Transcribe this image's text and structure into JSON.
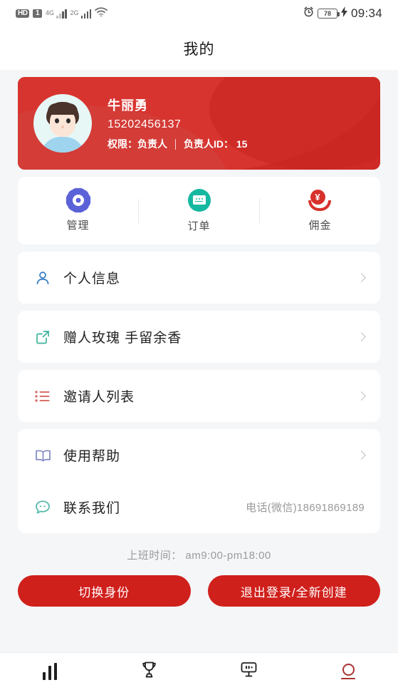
{
  "status_bar": {
    "hd_label": "HD",
    "sim_label": "1",
    "net_primary": "4G",
    "net_secondary": "2G",
    "wifi_icon": "wifi-icon",
    "alarm_icon": "alarm-icon",
    "battery_percent": "78",
    "charging_icon": "charging-bolt-icon",
    "time": "09:34"
  },
  "header": {
    "title": "我的"
  },
  "profile": {
    "avatar_icon": "user-avatar",
    "name": "牛丽勇",
    "phone": "15202456137",
    "role_text": "权限：负责人",
    "id_text": "负责人ID： 15",
    "card_color": "#cf2a26"
  },
  "quick_actions": [
    {
      "label": "管理",
      "icon": "gear-icon",
      "color": "#5b62d8"
    },
    {
      "label": "订单",
      "icon": "order-card-icon",
      "color": "#16b8a0"
    },
    {
      "label": "佣金",
      "icon": "commission-hand-yen-icon",
      "color": "#d8312c"
    }
  ],
  "menu_groups": [
    {
      "rows": [
        {
          "label": "个人信息",
          "icon": "person-icon",
          "icon_color": "#2f78c4",
          "right_text": "",
          "chevron": true
        }
      ]
    },
    {
      "rows": [
        {
          "label": "赠人玫瑰 手留余香",
          "icon": "share-external-icon",
          "icon_color": "#3cb39a",
          "right_text": "",
          "chevron": true
        }
      ]
    },
    {
      "rows": [
        {
          "label": "邀请人列表",
          "icon": "list-icon",
          "icon_color": "#d8706a",
          "right_text": "",
          "chevron": true
        }
      ]
    },
    {
      "rows": [
        {
          "label": "使用帮助",
          "icon": "book-icon",
          "icon_color": "#8289c4",
          "right_text": "",
          "chevron": true
        },
        {
          "label": "联系我们",
          "icon": "chat-bubble-icon",
          "icon_color": "#4fb7a8",
          "right_text": "电话(微信)18691869189",
          "chevron": false
        }
      ]
    }
  ],
  "worktime": "上班时间： am9:00-pm18:00",
  "buttons": {
    "switch_identity": "切换身份",
    "logout_create": "退出登录/全新创建",
    "color": "#d0201c"
  },
  "tabbar": {
    "items": [
      {
        "icon": "bar-chart-icon",
        "active": false
      },
      {
        "icon": "trophy-icon",
        "active": false
      },
      {
        "icon": "billboard-icon",
        "active": false
      },
      {
        "icon": "person-me-icon",
        "active": true
      }
    ],
    "active_color": "#a33"
  }
}
